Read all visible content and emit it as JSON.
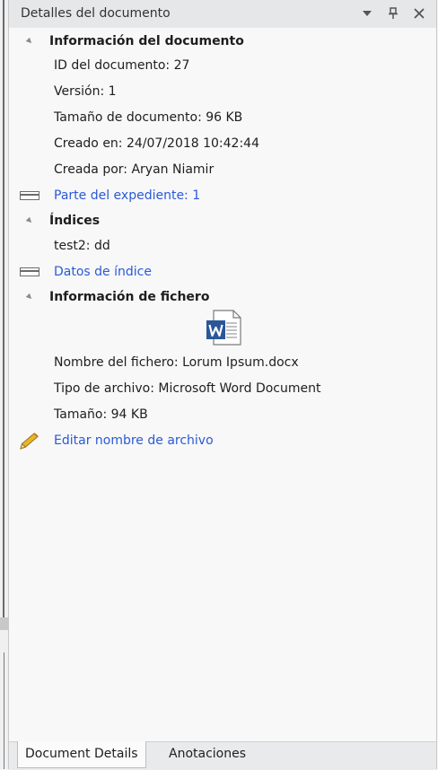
{
  "panel": {
    "title": "Detalles del documento",
    "controls": [
      "dropdown-icon",
      "pin-icon",
      "close-icon"
    ]
  },
  "sections": {
    "doc_info": {
      "title": "Información del documento",
      "id": "ID del documento: 27",
      "version": "Versión: 1",
      "size": "Tamaño de documento: 96 KB",
      "created_on": "Creado en: 24/07/2018 10:42:44",
      "created_by": "Creada por: Aryan Niamir"
    },
    "record_link": "Parte del expediente: 1",
    "indices": {
      "title": "Índices",
      "entry": "test2:  dd"
    },
    "index_data_link": "Datos de índice",
    "file_info": {
      "title": "Información de fichero",
      "file_icon": "word-document-icon",
      "file_name": "Nombre del fichero: Lorum Ipsum.docx",
      "file_type": "Tipo de archivo: Microsoft Word Document",
      "file_size": "Tamaño: 94 KB"
    },
    "edit_link": "Editar nombre de archivo"
  },
  "tabs": {
    "active": "Document Details",
    "other": "Anotaciones"
  },
  "colors": {
    "link": "#2a5ad7",
    "header_bg": "#e6e7e8",
    "word_blue": "#2b579a"
  }
}
